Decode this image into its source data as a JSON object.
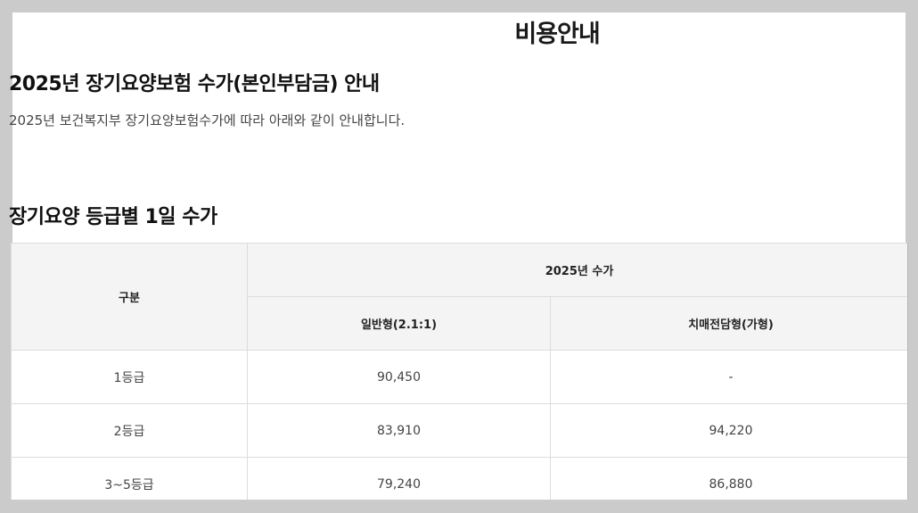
{
  "page": {
    "title": "비용안내"
  },
  "notice": {
    "heading": "2025년 장기요양보험 수가(본인부담금) 안내",
    "text": "2025년 보건복지부 장기요양보험수가에 따라 아래와 같이 안내합니다."
  },
  "rates": {
    "heading": "장기요양 등급별 1일 수가",
    "header": {
      "category": "구분",
      "group": "2025년 수가",
      "col_general": "일반형(2.1:1)",
      "col_dementia": "치매전담형(가형)"
    },
    "rows": [
      {
        "grade": "1등급",
        "general": "90,450",
        "dementia": "-"
      },
      {
        "grade": "2등급",
        "general": "83,910",
        "dementia": "94,220"
      },
      {
        "grade": "3~5등급",
        "general": "79,240",
        "dementia": "86,880"
      }
    ]
  },
  "colors": {
    "background": "#cbcbcb",
    "panel": "#ffffff",
    "header_bg": "#f4f4f4",
    "border": "#dcdcdc"
  }
}
